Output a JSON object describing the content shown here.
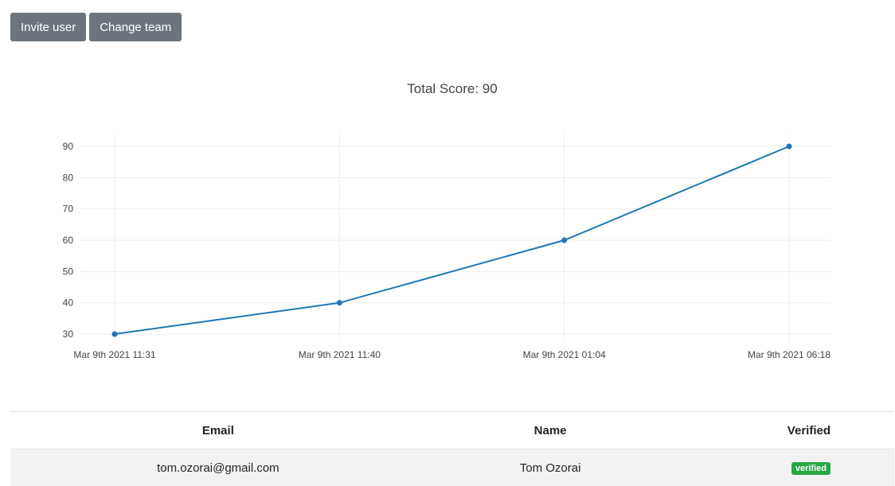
{
  "toolbar": {
    "invite_label": "Invite user",
    "change_team_label": "Change team"
  },
  "colors": {
    "button_bg": "#6c757d",
    "line": "#1f77b4",
    "badge": "#28a745"
  },
  "chart_data": {
    "type": "line",
    "title": "Total Score: 90",
    "xlabel": "",
    "ylabel": "",
    "categories": [
      "Mar 9th 2021 11:31",
      "Mar 9th 2021 11:40",
      "Mar 9th 2021 01:04",
      "Mar 9th 2021 06:18"
    ],
    "series": [
      {
        "values": [
          30,
          40,
          60,
          90
        ]
      }
    ],
    "yticks": [
      30,
      40,
      50,
      60,
      70,
      80,
      90
    ],
    "ylim": [
      27,
      94
    ],
    "grid": true
  },
  "table": {
    "headers": {
      "email": "Email",
      "name": "Name",
      "verified": "Verified"
    },
    "rows": [
      {
        "email": "tom.ozorai@gmail.com",
        "name": "Tom Ozorai",
        "verified": "verified"
      }
    ]
  }
}
